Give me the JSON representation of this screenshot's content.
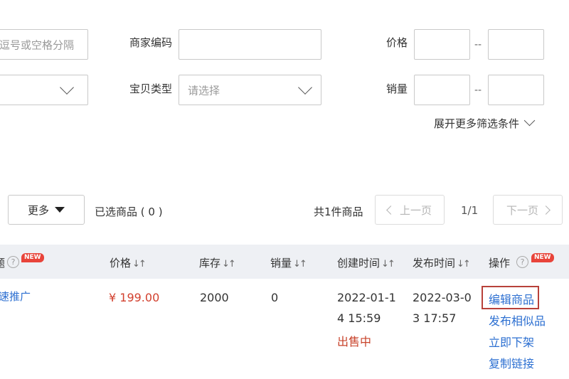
{
  "filters": {
    "id_input_placeholder": "逗号或空格分隔",
    "merchant_code_label": "商家编码",
    "price_label": "价格",
    "item_type_label": "宝贝类型",
    "item_type_placeholder": "请选择",
    "sales_label": "销量",
    "range_dash": "--",
    "more_filters": "展开更多筛选条件"
  },
  "toolbar": {
    "more_button": "更多",
    "selected_text": "已选商品 ( 0 )",
    "total_text": "共1件商品",
    "prev_page": "上一页",
    "page_indicator": "1/1",
    "next_page": "下一页"
  },
  "table": {
    "headers": {
      "title_col": "题",
      "new_badge": "NEW",
      "price": "价格",
      "stock": "库存",
      "sales": "销量",
      "created": "创建时间",
      "published": "发布时间",
      "actions": "操作"
    },
    "row": {
      "promo_link": "速推广",
      "price": "¥ 199.00",
      "stock": "2000",
      "sales": "0",
      "created_line1": "2022-01-1",
      "created_line2": "4 15:59",
      "status": "出售中",
      "published_line1": "2022-03-0",
      "published_line2": "3 17:57",
      "actions": [
        "编辑商品",
        "发布相似品",
        "立即下架",
        "复制链接"
      ]
    }
  }
}
